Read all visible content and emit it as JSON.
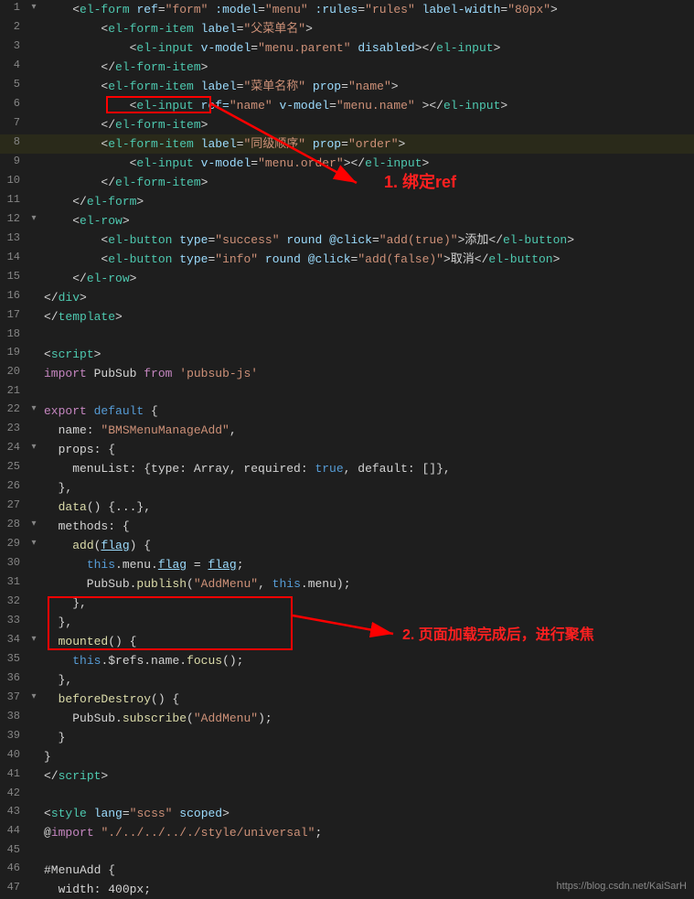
{
  "lines": [
    {
      "num": 1,
      "fold": true,
      "highlight": false,
      "html": "<span class='plain'>    &lt;</span><span class='tag'>el-form</span> <span class='attr'>ref</span><span class='punct'>=</span><span class='attr-val'>\"form\"</span> <span class='attr'>:model</span><span class='punct'>=</span><span class='attr-val'>\"menu\"</span> <span class='attr'>:rules</span><span class='punct'>=</span><span class='attr-val'>\"rules\"</span> <span class='attr'>label-width</span><span class='punct'>=</span><span class='attr-val'>\"80px\"</span><span class='plain'>&gt;</span>"
    },
    {
      "num": 2,
      "fold": false,
      "highlight": false,
      "html": "<span class='plain'>        &lt;</span><span class='tag'>el-form-item</span> <span class='attr'>label</span><span class='punct'>=</span><span class='attr-val'>\"父菜单名\"</span><span class='plain'>&gt;</span>"
    },
    {
      "num": 3,
      "fold": false,
      "highlight": false,
      "html": "<span class='plain'>            &lt;</span><span class='tag'>el-input</span> <span class='attr'>v-model</span><span class='punct'>=</span><span class='attr-val'>\"menu.parent\"</span> <span class='attr'>disabled</span><span class='plain'>&gt;&lt;/</span><span class='tag'>el-input</span><span class='plain'>&gt;</span>"
    },
    {
      "num": 4,
      "fold": false,
      "highlight": false,
      "html": "<span class='plain'>        &lt;/</span><span class='tag'>el-form-item</span><span class='plain'>&gt;</span>"
    },
    {
      "num": 5,
      "fold": false,
      "highlight": false,
      "html": "<span class='plain'>        &lt;</span><span class='tag'>el-form-item</span> <span class='attr'>label</span><span class='punct'>=</span><span class='attr-val'>\"菜单名称\"</span> <span class='attr'>prop</span><span class='punct'>=</span><span class='attr-val'>\"name\"</span><span class='plain'>&gt;</span>"
    },
    {
      "num": 6,
      "fold": false,
      "highlight": false,
      "html": "<span class='plain'>            &lt;</span><span class='tag'>el-input</span> <span class='attr ref-box'>ref=<span class='attr-val ref-box-val'>\"name\"</span></span> <span class='attr'>v-model</span><span class='punct'>=</span><span class='attr-val'>\"menu.name\"</span> <span class='plain'>&gt;&lt;/</span><span class='tag'>el-input</span><span class='plain'>&gt;</span>"
    },
    {
      "num": 7,
      "fold": false,
      "highlight": false,
      "html": "<span class='plain'>        &lt;/</span><span class='tag'>el-form-item</span><span class='plain'>&gt;</span>"
    },
    {
      "num": 8,
      "fold": false,
      "highlight": true,
      "html": "<span class='plain'>        &lt;</span><span class='tag'>el-form-item</span> <span class='attr'>label</span><span class='punct'>=</span><span class='attr-val'>\"同级顺序\"</span> <span class='attr'>prop</span><span class='punct'>=</span><span class='attr-val'>\"order\"</span><span class='plain'>&gt;</span>"
    },
    {
      "num": 9,
      "fold": false,
      "highlight": false,
      "html": "<span class='plain'>            &lt;</span><span class='tag'>el-input</span> <span class='attr'>v-model</span><span class='punct'>=</span><span class='attr-val'>\"menu.order\"</span><span class='plain'>&gt;&lt;/</span><span class='tag'>el-input</span><span class='plain'>&gt;</span>"
    },
    {
      "num": 10,
      "fold": false,
      "highlight": false,
      "html": "<span class='plain'>        &lt;/</span><span class='tag'>el-form-item</span><span class='plain'>&gt;</span>"
    },
    {
      "num": 11,
      "fold": false,
      "highlight": false,
      "html": "<span class='plain'>    &lt;/</span><span class='tag'>el-form</span><span class='plain'>&gt;</span>"
    },
    {
      "num": 12,
      "fold": true,
      "highlight": false,
      "html": "<span class='plain'>    &lt;</span><span class='tag'>el-row</span><span class='plain'>&gt;</span>"
    },
    {
      "num": 13,
      "fold": false,
      "highlight": false,
      "html": "<span class='plain'>        &lt;</span><span class='tag'>el-button</span> <span class='attr'>type</span><span class='punct'>=</span><span class='attr-val'>\"success\"</span> <span class='attr'>round</span> <span class='attr'>@click</span><span class='punct'>=</span><span class='attr-val'>\"add(true)\"</span><span class='plain'>&gt;添加&lt;/</span><span class='tag'>el-button</span><span class='plain'>&gt;</span>"
    },
    {
      "num": 14,
      "fold": false,
      "highlight": false,
      "html": "<span class='plain'>        &lt;</span><span class='tag'>el-button</span> <span class='attr'>type</span><span class='punct'>=</span><span class='attr-val'>\"info\"</span> <span class='attr'>round</span> <span class='attr'>@click</span><span class='punct'>=</span><span class='attr-val'>\"add(false)\"</span><span class='plain'>&gt;取消&lt;/</span><span class='tag'>el-button</span><span class='plain'>&gt;</span>"
    },
    {
      "num": 15,
      "fold": false,
      "highlight": false,
      "html": "<span class='plain'>    &lt;/</span><span class='tag'>el-row</span><span class='plain'>&gt;</span>"
    },
    {
      "num": 16,
      "fold": false,
      "highlight": false,
      "html": "<span class='plain'>&lt;/</span><span class='tag'>div</span><span class='plain'>&gt;</span>"
    },
    {
      "num": 17,
      "fold": false,
      "highlight": false,
      "html": "<span class='plain'>&lt;/</span><span class='tag'>template</span><span class='plain'>&gt;</span>"
    },
    {
      "num": 18,
      "fold": false,
      "highlight": false,
      "html": ""
    },
    {
      "num": 19,
      "fold": false,
      "highlight": false,
      "html": "<span class='plain'>&lt;</span><span class='tag'>script</span><span class='plain'>&gt;</span>"
    },
    {
      "num": 20,
      "fold": false,
      "highlight": false,
      "html": "<span class='import-kw'>import</span> <span class='plain'>PubSub </span><span class='import-kw'>from</span> <span class='string'>'pubsub-js'</span>"
    },
    {
      "num": 21,
      "fold": false,
      "highlight": false,
      "html": ""
    },
    {
      "num": 22,
      "fold": true,
      "highlight": false,
      "html": "<span class='export-kw'>export</span> <span class='default-kw'>default</span> <span class='plain'>{</span>"
    },
    {
      "num": 23,
      "fold": false,
      "highlight": false,
      "html": "<span class='plain'>  name: </span><span class='string'>\"BMSMenuManageAdd\"</span><span class='plain'>,</span>"
    },
    {
      "num": 24,
      "fold": true,
      "highlight": false,
      "html": "<span class='plain'>  props: {</span>"
    },
    {
      "num": 25,
      "fold": false,
      "highlight": false,
      "html": "<span class='plain'>    menuList: {type: Array, required: </span><span class='bool-val'>true</span><span class='plain'>, default: []},</span>"
    },
    {
      "num": 26,
      "fold": false,
      "highlight": false,
      "html": "<span class='plain'>  },</span>"
    },
    {
      "num": 27,
      "fold": false,
      "highlight": false,
      "html": "<span class='plain'>  </span><span class='method'>data</span><span class='plain'>() {...},</span>"
    },
    {
      "num": 28,
      "fold": true,
      "highlight": false,
      "html": "<span class='plain'>  methods: {</span>"
    },
    {
      "num": 29,
      "fold": true,
      "highlight": false,
      "html": "<span class='plain'>    </span><span class='method'>add</span><span class='plain'>(</span><span class='var underline'>flag</span><span class='plain'>) {</span>"
    },
    {
      "num": 30,
      "fold": false,
      "highlight": false,
      "html": "<span class='plain'>      </span><span class='keyword'>this</span><span class='plain'>.menu.</span><span class='var underline'>flag</span><span class='plain'> = </span><span class='var underline'>flag</span><span class='plain'>;</span>"
    },
    {
      "num": 31,
      "fold": false,
      "highlight": false,
      "html": "<span class='plain'>      PubSub.</span><span class='method'>publish</span><span class='plain'>(</span><span class='string'>\"AddMenu\"</span><span class='plain'>, </span><span class='keyword'>this</span><span class='plain'>.menu);</span>"
    },
    {
      "num": 32,
      "fold": false,
      "highlight": false,
      "html": "<span class='plain'>    },</span>"
    },
    {
      "num": 33,
      "fold": false,
      "highlight": false,
      "html": "<span class='plain'>  },</span>"
    },
    {
      "num": 34,
      "fold": true,
      "highlight": false,
      "html": "<span class='plain'>  </span><span class='method mounted-box'>mounted</span><span class='plain mounted-box'>() {</span>"
    },
    {
      "num": 35,
      "fold": false,
      "highlight": false,
      "html": "<span class='plain mounted-box'>    </span><span class='keyword mounted-box'>this</span><span class='plain mounted-box'>.$refs.name.</span><span class='method mounted-box'>focus</span><span class='plain mounted-box'>();</span>"
    },
    {
      "num": 36,
      "fold": false,
      "highlight": false,
      "html": "<span class='plain mounted-box'>  },</span>"
    },
    {
      "num": 37,
      "fold": true,
      "highlight": false,
      "html": "<span class='plain'>  </span><span class='method'>beforeDestroy</span><span class='plain'>() {</span>"
    },
    {
      "num": 38,
      "fold": false,
      "highlight": false,
      "html": "<span class='plain'>    PubSub.</span><span class='method'>subscribe</span><span class='plain'>(</span><span class='string'>\"AddMenu\"</span><span class='plain'>);</span>"
    },
    {
      "num": 39,
      "fold": false,
      "highlight": false,
      "html": "<span class='plain'>  }</span>"
    },
    {
      "num": 40,
      "fold": false,
      "highlight": false,
      "html": "<span class='plain'>}</span>"
    },
    {
      "num": 41,
      "fold": false,
      "highlight": false,
      "html": "<span class='plain'>&lt;/</span><span class='tag'>script</span><span class='plain'>&gt;</span>"
    },
    {
      "num": 42,
      "fold": false,
      "highlight": false,
      "html": ""
    },
    {
      "num": 43,
      "fold": false,
      "highlight": false,
      "html": "<span class='plain'>&lt;</span><span class='tag'>style</span> <span class='attr'>lang</span><span class='punct'>=</span><span class='attr-val'>\"scss\"</span> <span class='attr'>scoped</span><span class='plain'>&gt;</span>"
    },
    {
      "num": 44,
      "fold": false,
      "highlight": false,
      "html": "<span class='plain'>@</span><span class='import-kw'>import</span> <span class='string'>\"./../../.././style/universal\"</span><span class='plain'>;</span>"
    },
    {
      "num": 45,
      "fold": false,
      "highlight": false,
      "html": ""
    },
    {
      "num": 46,
      "fold": false,
      "highlight": false,
      "html": "<span class='plain'>#MenuAdd {</span>"
    },
    {
      "num": 47,
      "fold": false,
      "highlight": false,
      "html": "<span class='plain'>  width: 400px;</span>"
    }
  ],
  "annotations": {
    "ref_label": "1. 绑定ref",
    "mount_label": "2. 页面加载完成后，进行聚焦"
  },
  "watermark": "https://blog.csdn.net/KaiSarH"
}
